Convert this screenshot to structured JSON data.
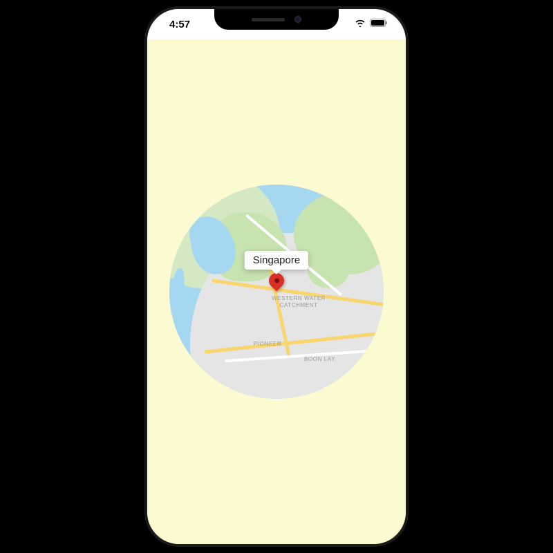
{
  "status_bar": {
    "time": "4:57",
    "wifi_icon": "wifi-icon",
    "battery_icon": "battery-icon"
  },
  "map": {
    "marker": {
      "title": "Singapore"
    },
    "districts": {
      "western_water": "WESTERN WATER\nCATCHMENT",
      "pioneer": "PIONEER",
      "boon_lay": "BOON LAY"
    }
  },
  "colors": {
    "app_background": "#fbfad0",
    "water": "#a5d8f0",
    "park": "#c7e3b0",
    "urban": "#e5e5e5",
    "highway": "#f9d56e",
    "pin": "#d93025"
  }
}
